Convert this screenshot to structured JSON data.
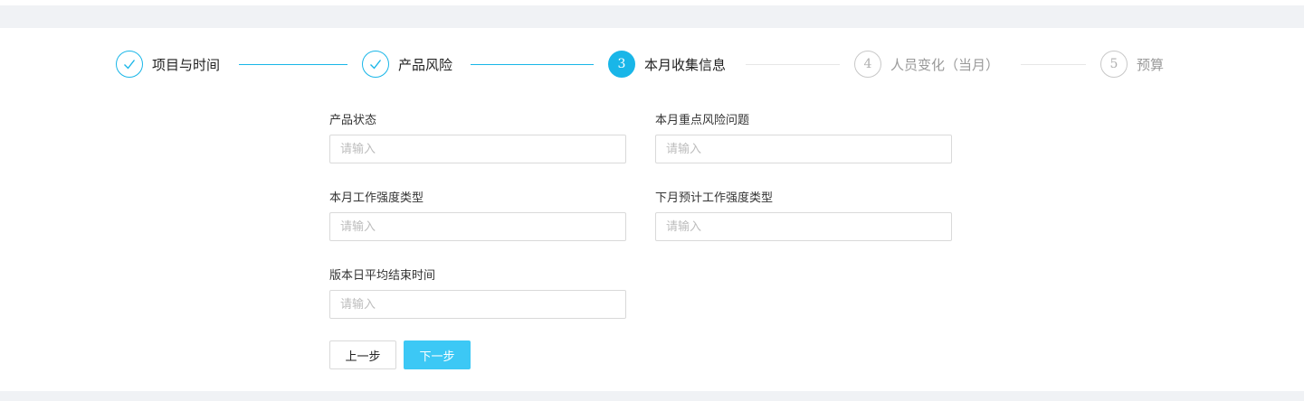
{
  "colors": {
    "accent": "#19b6e8",
    "button_primary": "#3cc8f5",
    "page_background": "#f0f2f5"
  },
  "steps": [
    {
      "index": "1",
      "label": "项目与时间",
      "status": "done",
      "icon": "check-icon"
    },
    {
      "index": "2",
      "label": "产品风险",
      "status": "done",
      "icon": "check-icon"
    },
    {
      "index": "3",
      "label": "本月收集信息",
      "status": "active"
    },
    {
      "index": "4",
      "label": "人员变化（当月）",
      "status": "wait"
    },
    {
      "index": "5",
      "label": "预算",
      "status": "wait"
    }
  ],
  "form": {
    "fields": [
      {
        "label": "产品状态",
        "placeholder": "请输入",
        "value": ""
      },
      {
        "label": "本月重点风险问题",
        "placeholder": "请输入",
        "value": ""
      },
      {
        "label": "本月工作强度类型",
        "placeholder": "请输入",
        "value": ""
      },
      {
        "label": "下月预计工作强度类型",
        "placeholder": "请输入",
        "value": ""
      },
      {
        "label": "版本日平均结束时间",
        "placeholder": "请输入",
        "value": ""
      }
    ]
  },
  "buttons": {
    "prev_label": "上一步",
    "next_label": "下一步"
  }
}
